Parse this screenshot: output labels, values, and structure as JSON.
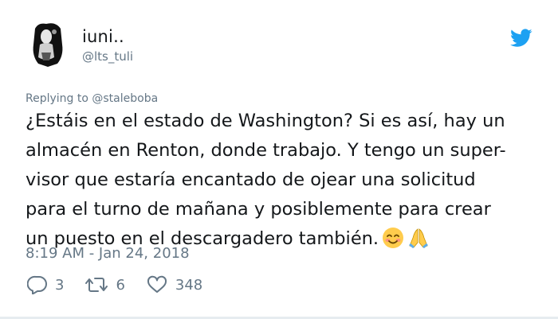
{
  "tweet": {
    "author": {
      "display_name": "iuni..",
      "handle": "@lts_tuli",
      "avatar_icon": "avatar-image"
    },
    "brand_icon": "twitter-bird-icon",
    "brand_color": "#1da1f2",
    "replying_prefix": "Replying to",
    "replying_to": "@staleboba",
    "text": "¿Estáis en el estado de Washington? Si es así, hay un\nalmacén en Renton, donde trabajo. Y tengo un super-\nvisor que estaría encantado de ojear una solicitud\npara el turno de mañana y posiblemente para crear\nun puesto en el descargadero también.",
    "emojis": [
      "smiling-face-icon",
      "folded-hands-icon"
    ],
    "timestamp": "8:19 AM - Jan 24, 2018",
    "stats": {
      "replies": "3",
      "retweets": "6",
      "likes": "348"
    }
  }
}
